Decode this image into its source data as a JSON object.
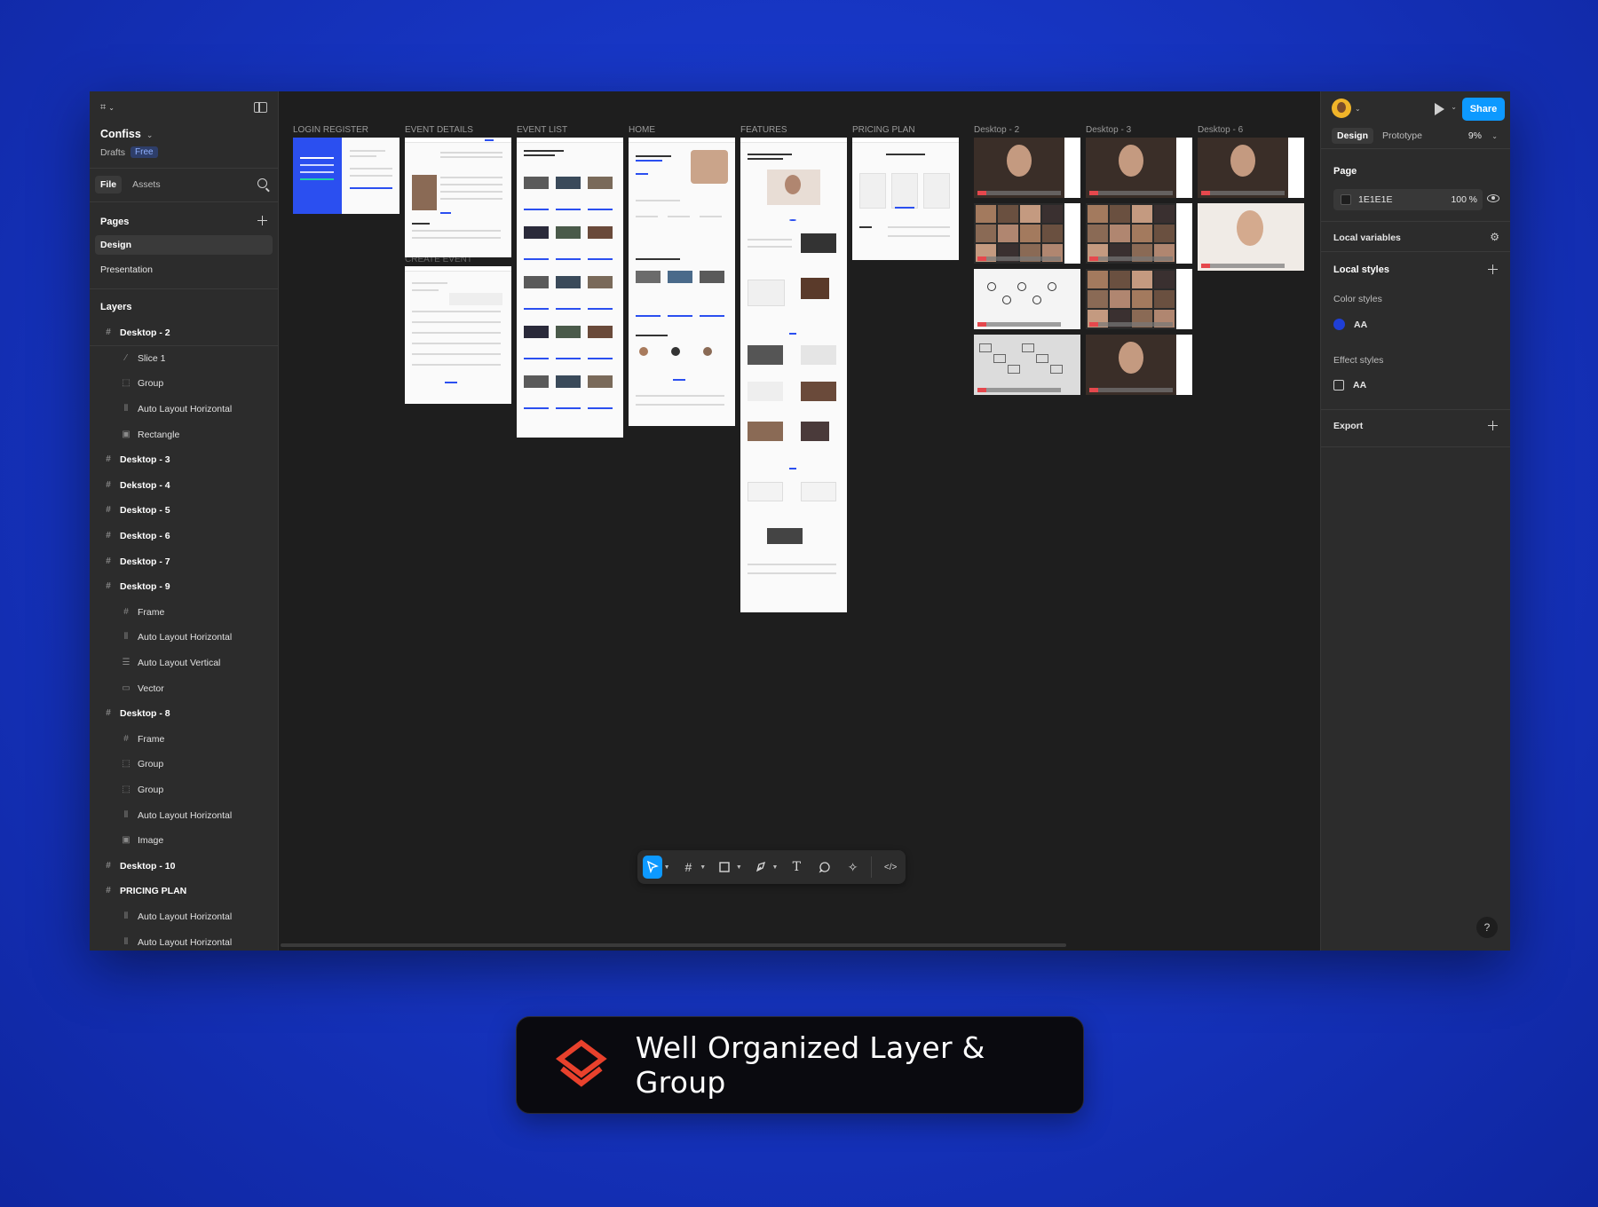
{
  "left_panel": {
    "file_name": "Confiss",
    "drafts_label": "Drafts",
    "plan_badge": "Free",
    "tabs": [
      "File",
      "Assets"
    ],
    "pages_heading": "Pages",
    "pages": [
      "Design",
      "Presentation"
    ],
    "layers_heading": "Layers",
    "layers": [
      {
        "name": "Desktop - 2",
        "level": 0,
        "icon": "frame-icon"
      },
      {
        "name": "Slice 1",
        "level": 1,
        "icon": "slice-icon"
      },
      {
        "name": "Group",
        "level": 1,
        "icon": "group-icon"
      },
      {
        "name": "Auto Layout Horizontal",
        "level": 1,
        "icon": "auto-layout-horizontal-icon"
      },
      {
        "name": "Rectangle",
        "level": 1,
        "icon": "image-icon"
      },
      {
        "name": "Desktop - 3",
        "level": 0,
        "icon": "frame-icon"
      },
      {
        "name": "Dekstop - 4",
        "level": 0,
        "icon": "frame-icon"
      },
      {
        "name": "Desktop - 5",
        "level": 0,
        "icon": "frame-icon"
      },
      {
        "name": "Desktop - 6",
        "level": 0,
        "icon": "frame-icon"
      },
      {
        "name": "Desktop - 7",
        "level": 0,
        "icon": "frame-icon"
      },
      {
        "name": "Desktop - 9",
        "level": 0,
        "icon": "frame-icon"
      },
      {
        "name": "Frame",
        "level": 1,
        "icon": "frame-icon"
      },
      {
        "name": "Auto Layout Horizontal",
        "level": 1,
        "icon": "auto-layout-horizontal-icon"
      },
      {
        "name": "Auto Layout Vertical",
        "level": 1,
        "icon": "auto-layout-vertical-icon"
      },
      {
        "name": "Vector",
        "level": 1,
        "icon": "vector-icon"
      },
      {
        "name": "Desktop - 8",
        "level": 0,
        "icon": "frame-icon"
      },
      {
        "name": "Frame",
        "level": 1,
        "icon": "frame-icon"
      },
      {
        "name": "Group",
        "level": 1,
        "icon": "group-icon"
      },
      {
        "name": "Group",
        "level": 1,
        "icon": "group-icon"
      },
      {
        "name": "Auto Layout Horizontal",
        "level": 1,
        "icon": "auto-layout-horizontal-icon"
      },
      {
        "name": "Image",
        "level": 1,
        "icon": "image-icon"
      },
      {
        "name": "Desktop - 10",
        "level": 0,
        "icon": "frame-icon"
      },
      {
        "name": "PRICING PLAN",
        "level": 0,
        "icon": "frame-icon"
      },
      {
        "name": "Auto Layout Horizontal",
        "level": 1,
        "icon": "auto-layout-horizontal-icon"
      },
      {
        "name": "Auto Layout Horizontal",
        "level": 1,
        "icon": "auto-layout-horizontal-icon"
      }
    ]
  },
  "canvas": {
    "frame_labels": {
      "login": "LOGIN REGISTER",
      "event_details": "EVENT DETAILS",
      "create_event": "CREATE EVENT",
      "event_list": "EVENT LIST",
      "home": "HOME",
      "features": "FEATURES",
      "pricing": "PRICING PLAN",
      "d2": "Desktop - 2",
      "d3": "Desktop - 3",
      "d6": "Desktop - 6"
    },
    "toolbar_tools": [
      "move-tool",
      "frame-tool",
      "shape-tool",
      "pen-tool",
      "text-tool",
      "comment-tool",
      "actions-tool",
      "dev-mode-toggle"
    ]
  },
  "right_panel": {
    "tabs": [
      "Design",
      "Prototype"
    ],
    "zoom": "9%",
    "share_label": "Share",
    "page_heading": "Page",
    "page_color": "1E1E1E",
    "page_opacity": "100",
    "opacity_unit": "%",
    "local_variables": "Local variables",
    "local_styles": "Local styles",
    "color_styles": "Color styles",
    "color_style_name": "AA",
    "effect_styles": "Effect styles",
    "effect_style_name": "AA",
    "export": "Export",
    "help": "?"
  },
  "callout": {
    "text": "Well Organized Layer & Group",
    "icon": "layers-icon",
    "icon_color": "#e8412c"
  },
  "colors": {
    "accent": "#0d99ff",
    "brand_blue": "#2b4ff0",
    "background": "#1736c4"
  }
}
